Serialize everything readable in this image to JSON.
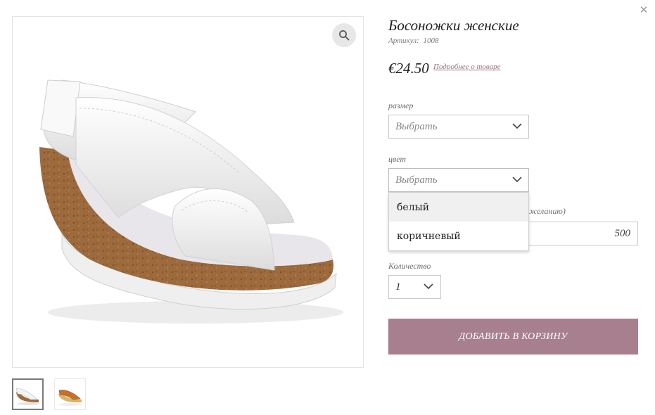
{
  "product": {
    "title": "Босоножки женские",
    "sku_label": "Артикул:",
    "sku_value": "1008",
    "price": "€24.50",
    "more_link": "Подробнее о товаре"
  },
  "options": {
    "size_label": "размер",
    "size_placeholder": "Выбрать",
    "color_label": "цвет",
    "color_placeholder": "Выбрать",
    "color_choices": [
      "белый",
      "коричневый"
    ],
    "hidden_label_fragment": "желанию)",
    "price_input_value": "500",
    "quantity_label": "Количество",
    "quantity_value": "1"
  },
  "actions": {
    "add_to_cart": "ДОБАВИТЬ В КОРЗИНУ"
  },
  "colors": {
    "accent": "#a77f8f",
    "link": "#9c7183",
    "border": "#c8c8c8"
  },
  "icons": {
    "zoom": "magnifier-icon",
    "close": "close-icon",
    "chevron": "chevron-down-icon"
  }
}
